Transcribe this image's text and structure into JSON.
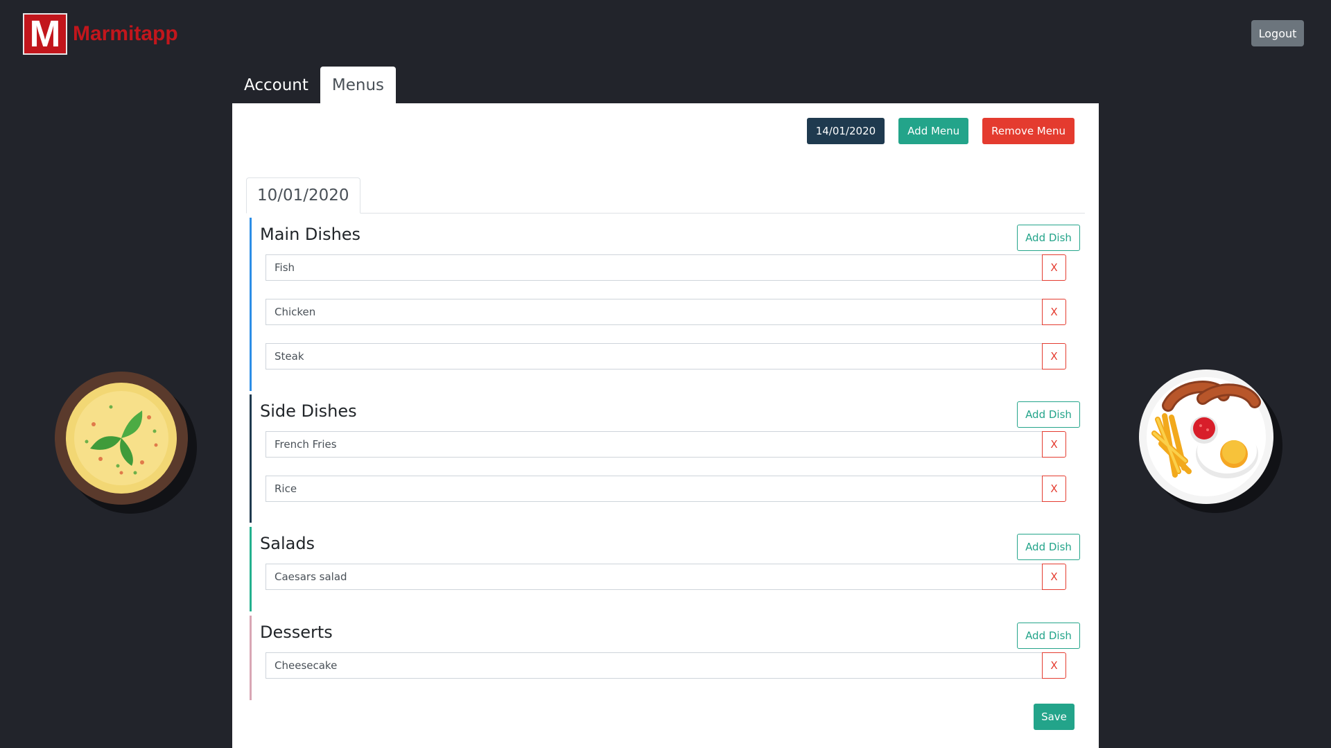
{
  "header": {
    "logo_letter": "M",
    "app_name": "Marmitapp",
    "logout_label": "Logout"
  },
  "tabs": [
    {
      "label": "Account",
      "active": false
    },
    {
      "label": "Menus",
      "active": true
    }
  ],
  "toolbar": {
    "date_label": "14/01/2020",
    "add_menu_label": "Add Menu",
    "remove_menu_label": "Remove Menu"
  },
  "menu": {
    "date_tab_label": "10/01/2020",
    "add_dish_label": "Add Dish",
    "remove_dish_label": "X",
    "save_label": "Save",
    "sections": [
      {
        "title": "Main Dishes",
        "dishes": [
          "Fish",
          "Chicken",
          "Steak"
        ]
      },
      {
        "title": "Side Dishes",
        "dishes": [
          "French Fries",
          "Rice"
        ]
      },
      {
        "title": "Salads",
        "dishes": [
          "Caesars salad"
        ]
      },
      {
        "title": "Desserts",
        "dishes": [
          "Cheesecake"
        ]
      }
    ]
  },
  "colors": {
    "background": "#22242b",
    "brand_red": "#c2161c",
    "accent_green": "#23a48a",
    "danger_red": "#e43b2f",
    "date_button": "#1f3a4f",
    "main_dishes_border": "#2d8ee6",
    "side_dishes_border": "#1f3a4f",
    "salads_border": "#23b08e",
    "desserts_border": "#d9a6b4"
  },
  "decorations": {
    "left": "soup-bowl-icon",
    "right": "breakfast-plate-icon"
  }
}
